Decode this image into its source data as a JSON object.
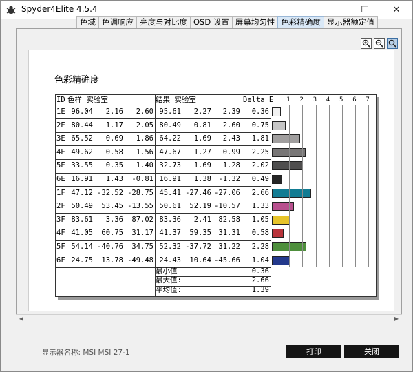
{
  "window": {
    "title": "Spyder4Elite 4.5.4",
    "minimize_glyph": "—",
    "maximize_glyph": "☐",
    "close_glyph": "✕"
  },
  "tabs": [
    {
      "label": "色域",
      "active": false
    },
    {
      "label": "色调响应",
      "active": false
    },
    {
      "label": "亮度与对比度",
      "active": false
    },
    {
      "label": "OSD 设置",
      "active": false
    },
    {
      "label": "屏幕均匀性",
      "active": false
    },
    {
      "label": "色彩精确度",
      "active": true
    },
    {
      "label": "显示器额定值",
      "active": false
    }
  ],
  "zoom_buttons": [
    {
      "icon": "zoom-in-icon"
    },
    {
      "icon": "zoom-out-icon"
    },
    {
      "icon": "zoom-fit-icon"
    }
  ],
  "report": {
    "title": "色彩精确度",
    "headers": {
      "id": "ID",
      "sample": "色样 实验室",
      "result": "结果 实验室",
      "delta": "Delta E"
    },
    "axis_ticks": [
      "1",
      "2",
      "3",
      "4",
      "5",
      "6",
      "7"
    ],
    "rows": [
      {
        "id": "1E",
        "s": [
          "96.04",
          "2.16",
          "2.60"
        ],
        "r": [
          "95.61",
          "2.27",
          "2.39"
        ],
        "delta": "0.36",
        "de": 0.36,
        "color": "#f2f2f2"
      },
      {
        "id": "2E",
        "s": [
          "80.44",
          "1.17",
          "2.05"
        ],
        "r": [
          "80.49",
          "0.81",
          "2.60"
        ],
        "delta": "0.75",
        "de": 0.75,
        "color": "#c6c6c6"
      },
      {
        "id": "3E",
        "s": [
          "65.52",
          "0.69",
          "1.86"
        ],
        "r": [
          "64.22",
          "1.69",
          "2.43"
        ],
        "delta": "1.81",
        "de": 1.81,
        "color": "#a09e9e"
      },
      {
        "id": "4E",
        "s": [
          "49.62",
          "0.58",
          "1.56"
        ],
        "r": [
          "47.67",
          "1.27",
          "0.99"
        ],
        "delta": "2.25",
        "de": 2.25,
        "color": "#787676"
      },
      {
        "id": "5E",
        "s": [
          "33.55",
          "0.35",
          "1.40"
        ],
        "r": [
          "32.73",
          "1.69",
          "1.28"
        ],
        "delta": "2.02",
        "de": 2.02,
        "color": "#4f4e4e"
      },
      {
        "id": "6E",
        "s": [
          "16.91",
          "1.43",
          "-0.81"
        ],
        "r": [
          "16.91",
          "1.38",
          "-1.32"
        ],
        "delta": "0.49",
        "de": 0.49,
        "color": "#262626"
      },
      {
        "id": "1F",
        "s": [
          "47.12",
          "-32.52",
          "-28.75"
        ],
        "r": [
          "45.41",
          "-27.46",
          "-27.06"
        ],
        "delta": "2.66",
        "de": 2.66,
        "color": "#127c93"
      },
      {
        "id": "2F",
        "s": [
          "50.49",
          "53.45",
          "-13.55"
        ],
        "r": [
          "50.61",
          "52.19",
          "-10.57"
        ],
        "delta": "1.33",
        "de": 1.33,
        "color": "#b8508e"
      },
      {
        "id": "3F",
        "s": [
          "83.61",
          "3.36",
          "87.02"
        ],
        "r": [
          "83.36",
          "2.41",
          "82.58"
        ],
        "delta": "1.05",
        "de": 1.05,
        "color": "#e7c42a"
      },
      {
        "id": "4F",
        "s": [
          "41.05",
          "60.75",
          "31.17"
        ],
        "r": [
          "41.37",
          "59.35",
          "31.31"
        ],
        "delta": "0.58",
        "de": 0.58,
        "color": "#b8333a"
      },
      {
        "id": "5F",
        "s": [
          "54.14",
          "-40.76",
          "34.75"
        ],
        "r": [
          "52.32",
          "-37.72",
          "31.22"
        ],
        "delta": "2.28",
        "de": 2.28,
        "color": "#4e8f3c"
      },
      {
        "id": "6F",
        "s": [
          "24.75",
          "13.78",
          "-49.48"
        ],
        "r": [
          "24.43",
          "10.64",
          "-45.66"
        ],
        "delta": "1.04",
        "de": 1.04,
        "color": "#23398c"
      }
    ],
    "summary": [
      {
        "label": "最小值",
        "value": "0.36"
      },
      {
        "label": "最大值:",
        "value": "2.66"
      },
      {
        "label": "平均值:",
        "value": "1.39"
      }
    ]
  },
  "footer": {
    "display_name": "显示器名称: MSI MSI 27-1",
    "print_label": "打印",
    "close_label": "关闭"
  }
}
